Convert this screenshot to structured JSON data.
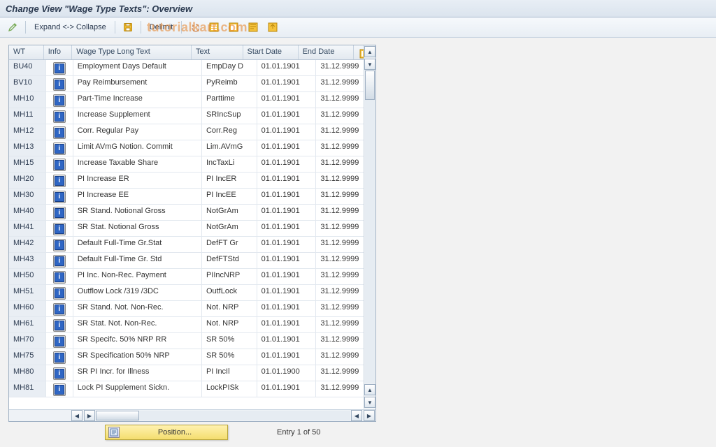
{
  "title": "Change View \"Wage Type Texts\": Overview",
  "toolbar": {
    "expand_collapse": "Expand <-> Collapse",
    "delimit": "Delimit"
  },
  "watermark": "tutorialkart.com",
  "columns": {
    "wt": "WT",
    "info": "Info",
    "long": "Wage Type Long Text",
    "text": "Text",
    "start": "Start Date",
    "end": "End Date"
  },
  "rows": [
    {
      "wt": "BU40",
      "long": "Employment Days Default",
      "text": "EmpDay D",
      "sd": "01.01.1901",
      "ed": "31.12.9999"
    },
    {
      "wt": "BV10",
      "long": "Pay Reimbursement",
      "text": "PyReimb",
      "sd": "01.01.1901",
      "ed": "31.12.9999"
    },
    {
      "wt": "MH10",
      "long": "Part-Time Increase",
      "text": "Parttime",
      "sd": "01.01.1901",
      "ed": "31.12.9999"
    },
    {
      "wt": "MH11",
      "long": "Increase Supplement",
      "text": "SRIncSup",
      "sd": "01.01.1901",
      "ed": "31.12.9999"
    },
    {
      "wt": "MH12",
      "long": "Corr. Regular Pay",
      "text": "Corr.Reg",
      "sd": "01.01.1901",
      "ed": "31.12.9999"
    },
    {
      "wt": "MH13",
      "long": "Limit AVmG Notion. Commit",
      "text": "Lim.AVmG",
      "sd": "01.01.1901",
      "ed": "31.12.9999"
    },
    {
      "wt": "MH15",
      "long": "Increase Taxable Share",
      "text": "IncTaxLi",
      "sd": "01.01.1901",
      "ed": "31.12.9999"
    },
    {
      "wt": "MH20",
      "long": "PI Increase ER",
      "text": "PI IncER",
      "sd": "01.01.1901",
      "ed": "31.12.9999"
    },
    {
      "wt": "MH30",
      "long": "PI Increase EE",
      "text": "PI IncEE",
      "sd": "01.01.1901",
      "ed": "31.12.9999"
    },
    {
      "wt": "MH40",
      "long": "SR Stand. Notional Gross",
      "text": "NotGrAm",
      "sd": "01.01.1901",
      "ed": "31.12.9999"
    },
    {
      "wt": "MH41",
      "long": "SR Stat. Notional Gross",
      "text": "NotGrAm",
      "sd": "01.01.1901",
      "ed": "31.12.9999"
    },
    {
      "wt": "MH42",
      "long": "Default Full-Time Gr.Stat",
      "text": "DefFT Gr",
      "sd": "01.01.1901",
      "ed": "31.12.9999"
    },
    {
      "wt": "MH43",
      "long": "Default Full-Time Gr. Std",
      "text": "DefFTStd",
      "sd": "01.01.1901",
      "ed": "31.12.9999"
    },
    {
      "wt": "MH50",
      "long": "PI Inc. Non-Rec. Payment",
      "text": "PIIncNRP",
      "sd": "01.01.1901",
      "ed": "31.12.9999"
    },
    {
      "wt": "MH51",
      "long": "Outflow Lock /319 /3DC",
      "text": "OutfLock",
      "sd": "01.01.1901",
      "ed": "31.12.9999"
    },
    {
      "wt": "MH60",
      "long": "SR Stand. Not. Non-Rec.",
      "text": "Not. NRP",
      "sd": "01.01.1901",
      "ed": "31.12.9999"
    },
    {
      "wt": "MH61",
      "long": "SR Stat. Not. Non-Rec.",
      "text": "Not. NRP",
      "sd": "01.01.1901",
      "ed": "31.12.9999"
    },
    {
      "wt": "MH70",
      "long": "SR Specifc. 50% NRP RR",
      "text": "SR 50%",
      "sd": "01.01.1901",
      "ed": "31.12.9999"
    },
    {
      "wt": "MH75",
      "long": "SR Specification 50% NRP",
      "text": "SR 50%",
      "sd": "01.01.1901",
      "ed": "31.12.9999"
    },
    {
      "wt": "MH80",
      "long": "SR PI Incr. for Illness",
      "text": "PI IncIl",
      "sd": "01.01.1900",
      "ed": "31.12.9999"
    },
    {
      "wt": "MH81",
      "long": "Lock PI Supplement Sickn.",
      "text": "LockPISk",
      "sd": "01.01.1901",
      "ed": "31.12.9999"
    }
  ],
  "footer": {
    "position_label": "Position...",
    "entry_text": "Entry 1 of 50"
  }
}
